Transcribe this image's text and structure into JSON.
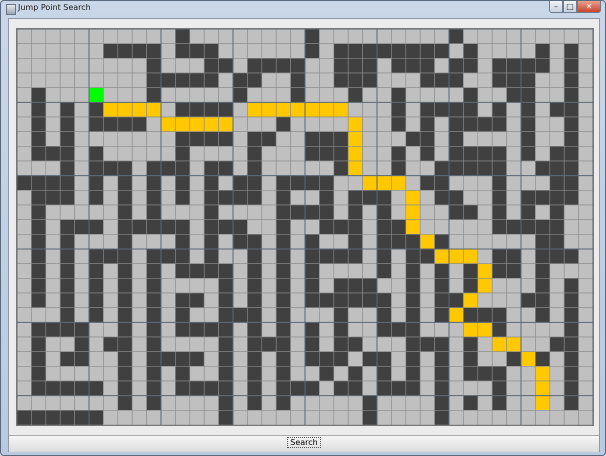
{
  "window": {
    "title": "Jump Point Search",
    "controls": {
      "minimize": "–",
      "maximize": "□",
      "close": "✕"
    }
  },
  "toolbar": {
    "search_label": "Search"
  },
  "colors": {
    "free": "#c0c0c0",
    "wall": "#404040",
    "start": "#00ff00",
    "path": "#ffc800",
    "cell_line": "#8c8c8c",
    "block_line": "#5c6878"
  },
  "grid": {
    "rows": 27,
    "cols": 40,
    "block_size": 5,
    "cells": [
      "0000000000000000000000000000000000000000",
      "00000000000000000000010001111111101000010",
      "00000000000000000000000000000000000000000",
      "0000000000000000000000000000000000000000",
      "0000000000000000000000000000000000000000",
      "0000000000000000000000000000000000000000",
      "0000000000000000000000000000000000000000",
      "0000000000000000000000000000000000000000",
      "0000000000000000000000000000000000000000",
      "0000000000000000000000000000000000000000",
      "0000000000000000000000000000000000000000",
      "0000000000000000000000000000000000000000",
      "0000000000000000000000000000000000000000",
      "0000000000000000000000000000000000000000",
      "0000000000000000000000000000000000000000",
      "0000000000000000000000000000000000000000",
      "0000000000000000000000000000000000000000",
      "0000000000000000000000000000000000000000",
      "0000000000000000000000000000000000000000",
      "0000000000000000000000000000000000000000",
      "0000000000000000000000000000000000000000",
      "0000000000000000000000000000000000000000",
      "0000000000000000000000000000000000000000",
      "0000000000000000000000000000000000000000",
      "0000000000000000000000000000000000000000",
      "0000000000000000000000000000000000000000",
      "0000000000000000000000000000000000000000"
    ],
    "walls": [
      [
        1,
        6,
        9
      ],
      [
        1,
        11,
        13
      ],
      [
        1,
        20,
        20
      ],
      [
        1,
        22,
        29
      ],
      [
        1,
        31,
        31
      ],
      [
        1,
        36,
        36
      ],
      [
        1,
        38,
        38
      ],
      [
        0,
        11,
        11
      ],
      [
        0,
        20,
        20
      ],
      [
        0,
        30,
        30
      ],
      [
        2,
        9,
        9
      ],
      [
        2,
        13,
        14
      ],
      [
        2,
        16,
        19
      ],
      [
        2,
        22,
        24
      ],
      [
        2,
        26,
        28
      ],
      [
        2,
        30,
        31
      ],
      [
        2,
        33,
        36
      ],
      [
        2,
        38,
        38
      ],
      [
        3,
        9,
        13
      ],
      [
        3,
        15,
        16
      ],
      [
        3,
        19,
        19
      ],
      [
        3,
        22,
        24
      ],
      [
        3,
        28,
        30
      ],
      [
        3,
        33,
        35
      ],
      [
        3,
        38,
        38
      ],
      [
        4,
        1,
        1
      ],
      [
        4,
        9,
        9
      ],
      [
        4,
        15,
        15
      ],
      [
        4,
        19,
        19
      ],
      [
        4,
        23,
        23
      ],
      [
        4,
        26,
        26
      ],
      [
        4,
        31,
        31
      ],
      [
        4,
        34,
        35
      ],
      [
        4,
        38,
        38
      ],
      [
        5,
        1,
        1
      ],
      [
        5,
        3,
        3
      ],
      [
        5,
        5,
        5
      ],
      [
        5,
        9,
        9
      ],
      [
        5,
        11,
        14
      ],
      [
        5,
        18,
        22
      ],
      [
        5,
        26,
        26
      ],
      [
        5,
        28,
        31
      ],
      [
        5,
        33,
        33
      ],
      [
        5,
        35,
        35
      ],
      [
        5,
        37,
        38
      ],
      [
        6,
        1,
        1
      ],
      [
        6,
        3,
        3
      ],
      [
        6,
        5,
        8
      ],
      [
        6,
        13,
        13
      ],
      [
        6,
        18,
        18
      ],
      [
        6,
        26,
        26
      ],
      [
        6,
        28,
        28
      ],
      [
        6,
        30,
        33
      ],
      [
        6,
        35,
        35
      ],
      [
        6,
        38,
        38
      ],
      [
        7,
        1,
        1
      ],
      [
        7,
        3,
        3
      ],
      [
        7,
        11,
        14
      ],
      [
        7,
        16,
        17
      ],
      [
        7,
        20,
        22
      ],
      [
        7,
        27,
        28
      ],
      [
        7,
        30,
        30
      ],
      [
        7,
        35,
        35
      ],
      [
        7,
        38,
        38
      ],
      [
        8,
        1,
        2
      ],
      [
        8,
        3,
        3
      ],
      [
        8,
        5,
        5
      ],
      [
        8,
        11,
        11
      ],
      [
        8,
        16,
        16
      ],
      [
        8,
        20,
        22
      ],
      [
        8,
        26,
        26
      ],
      [
        8,
        28,
        28
      ],
      [
        8,
        30,
        33
      ],
      [
        8,
        35,
        35
      ],
      [
        8,
        37,
        38
      ],
      [
        9,
        3,
        3
      ],
      [
        9,
        5,
        7
      ],
      [
        9,
        9,
        10
      ],
      [
        9,
        11,
        11
      ],
      [
        9,
        13,
        14
      ],
      [
        9,
        16,
        16
      ],
      [
        9,
        22,
        22
      ],
      [
        9,
        26,
        26
      ],
      [
        9,
        29,
        33
      ],
      [
        9,
        36,
        38
      ],
      [
        10,
        0,
        3
      ],
      [
        10,
        5,
        5
      ],
      [
        10,
        7,
        7
      ],
      [
        10,
        9,
        9
      ],
      [
        10,
        11,
        11
      ],
      [
        10,
        13,
        13
      ],
      [
        10,
        15,
        16
      ],
      [
        10,
        18,
        21
      ],
      [
        10,
        28,
        29
      ],
      [
        10,
        33,
        33
      ],
      [
        10,
        37,
        38
      ],
      [
        11,
        1,
        3
      ],
      [
        11,
        5,
        5
      ],
      [
        11,
        7,
        7
      ],
      [
        11,
        9,
        9
      ],
      [
        11,
        11,
        11
      ],
      [
        11,
        13,
        16
      ],
      [
        11,
        18,
        18
      ],
      [
        11,
        21,
        21
      ],
      [
        11,
        23,
        25
      ],
      [
        11,
        29,
        30
      ],
      [
        11,
        33,
        33
      ],
      [
        11,
        35,
        38
      ],
      [
        12,
        1,
        1
      ],
      [
        12,
        7,
        7
      ],
      [
        12,
        9,
        9
      ],
      [
        12,
        13,
        13
      ],
      [
        12,
        18,
        21
      ],
      [
        12,
        23,
        23
      ],
      [
        12,
        25,
        25
      ],
      [
        12,
        30,
        31
      ],
      [
        12,
        33,
        33
      ],
      [
        12,
        35,
        35
      ],
      [
        12,
        37,
        37
      ],
      [
        13,
        1,
        1
      ],
      [
        13,
        3,
        5
      ],
      [
        13,
        7,
        11
      ],
      [
        13,
        13,
        15
      ],
      [
        13,
        18,
        18
      ],
      [
        13,
        21,
        23
      ],
      [
        13,
        25,
        26
      ],
      [
        13,
        33,
        36
      ],
      [
        13,
        37,
        37
      ],
      [
        14,
        1,
        1
      ],
      [
        14,
        3,
        3
      ],
      [
        14,
        7,
        7
      ],
      [
        14,
        11,
        11
      ],
      [
        14,
        13,
        13
      ],
      [
        14,
        15,
        16
      ],
      [
        14,
        18,
        18
      ],
      [
        14,
        20,
        20
      ],
      [
        14,
        23,
        23
      ],
      [
        14,
        25,
        29
      ],
      [
        14,
        36,
        37
      ],
      [
        15,
        1,
        1
      ],
      [
        15,
        3,
        3
      ],
      [
        15,
        5,
        7
      ],
      [
        15,
        9,
        10
      ],
      [
        15,
        11,
        11
      ],
      [
        15,
        13,
        13
      ],
      [
        15,
        16,
        16
      ],
      [
        15,
        18,
        18
      ],
      [
        15,
        20,
        23
      ],
      [
        15,
        25,
        25
      ],
      [
        15,
        27,
        29
      ],
      [
        15,
        33,
        34
      ],
      [
        15,
        36,
        38
      ],
      [
        16,
        1,
        1
      ],
      [
        16,
        3,
        3
      ],
      [
        16,
        5,
        5
      ],
      [
        16,
        7,
        7
      ],
      [
        16,
        9,
        9
      ],
      [
        16,
        11,
        14
      ],
      [
        16,
        16,
        16
      ],
      [
        16,
        18,
        18
      ],
      [
        16,
        20,
        20
      ],
      [
        16,
        25,
        25
      ],
      [
        16,
        27,
        27
      ],
      [
        16,
        29,
        29
      ],
      [
        16,
        31,
        31
      ],
      [
        16,
        33,
        34
      ],
      [
        16,
        36,
        36
      ],
      [
        17,
        1,
        1
      ],
      [
        17,
        3,
        3
      ],
      [
        17,
        5,
        5
      ],
      [
        17,
        7,
        7
      ],
      [
        17,
        9,
        9
      ],
      [
        17,
        14,
        14
      ],
      [
        17,
        16,
        16
      ],
      [
        17,
        18,
        18
      ],
      [
        17,
        20,
        20
      ],
      [
        17,
        22,
        24
      ],
      [
        17,
        27,
        27
      ],
      [
        17,
        29,
        29
      ],
      [
        17,
        31,
        31
      ],
      [
        17,
        36,
        36
      ],
      [
        17,
        38,
        38
      ],
      [
        18,
        1,
        1
      ],
      [
        18,
        3,
        3
      ],
      [
        18,
        5,
        5
      ],
      [
        18,
        7,
        7
      ],
      [
        18,
        9,
        9
      ],
      [
        18,
        11,
        12
      ],
      [
        18,
        14,
        14
      ],
      [
        18,
        16,
        16
      ],
      [
        18,
        18,
        18
      ],
      [
        18,
        20,
        25
      ],
      [
        18,
        27,
        27
      ],
      [
        18,
        29,
        31
      ],
      [
        18,
        35,
        36
      ],
      [
        18,
        38,
        38
      ],
      [
        19,
        3,
        3
      ],
      [
        19,
        5,
        5
      ],
      [
        19,
        7,
        7
      ],
      [
        19,
        9,
        9
      ],
      [
        19,
        11,
        11
      ],
      [
        19,
        14,
        16
      ],
      [
        19,
        18,
        18
      ],
      [
        19,
        22,
        22
      ],
      [
        19,
        25,
        25
      ],
      [
        19,
        27,
        27
      ],
      [
        19,
        29,
        29
      ],
      [
        19,
        31,
        33
      ],
      [
        19,
        36,
        36
      ],
      [
        19,
        38,
        38
      ],
      [
        20,
        1,
        4
      ],
      [
        20,
        7,
        7
      ],
      [
        20,
        9,
        9
      ],
      [
        20,
        11,
        14
      ],
      [
        20,
        16,
        16
      ],
      [
        20,
        18,
        18
      ],
      [
        20,
        20,
        20
      ],
      [
        20,
        22,
        22
      ],
      [
        20,
        25,
        26
      ],
      [
        20,
        27,
        27
      ],
      [
        20,
        31,
        31
      ],
      [
        20,
        33,
        33
      ],
      [
        20,
        38,
        38
      ],
      [
        21,
        1,
        1
      ],
      [
        21,
        4,
        4
      ],
      [
        21,
        6,
        7
      ],
      [
        21,
        9,
        9
      ],
      [
        21,
        14,
        14
      ],
      [
        21,
        16,
        17
      ],
      [
        21,
        18,
        18
      ],
      [
        21,
        20,
        20
      ],
      [
        21,
        22,
        23
      ],
      [
        21,
        27,
        29
      ],
      [
        21,
        31,
        31
      ],
      [
        21,
        33,
        34
      ],
      [
        21,
        37,
        38
      ],
      [
        22,
        1,
        1
      ],
      [
        22,
        3,
        4
      ],
      [
        22,
        7,
        7
      ],
      [
        22,
        9,
        12
      ],
      [
        22,
        14,
        14
      ],
      [
        22,
        16,
        16
      ],
      [
        22,
        18,
        18
      ],
      [
        22,
        20,
        22
      ],
      [
        22,
        24,
        25
      ],
      [
        22,
        27,
        27
      ],
      [
        22,
        29,
        29
      ],
      [
        22,
        31,
        31
      ],
      [
        22,
        34,
        34
      ],
      [
        22,
        36,
        36
      ],
      [
        22,
        38,
        38
      ],
      [
        23,
        1,
        1
      ],
      [
        23,
        7,
        7
      ],
      [
        23,
        9,
        9
      ],
      [
        23,
        11,
        11
      ],
      [
        23,
        14,
        14
      ],
      [
        23,
        16,
        16
      ],
      [
        23,
        18,
        18
      ],
      [
        23,
        21,
        21
      ],
      [
        23,
        23,
        23
      ],
      [
        23,
        25,
        25
      ],
      [
        23,
        27,
        27
      ],
      [
        23,
        29,
        29
      ],
      [
        23,
        31,
        33
      ],
      [
        23,
        36,
        36
      ],
      [
        23,
        38,
        38
      ],
      [
        24,
        1,
        5
      ],
      [
        24,
        7,
        7
      ],
      [
        24,
        9,
        9
      ],
      [
        24,
        11,
        14
      ],
      [
        24,
        16,
        16
      ],
      [
        24,
        18,
        20
      ],
      [
        24,
        22,
        23
      ],
      [
        24,
        25,
        27
      ],
      [
        24,
        29,
        29
      ],
      [
        24,
        33,
        33
      ],
      [
        24,
        36,
        36
      ],
      [
        24,
        38,
        38
      ],
      [
        25,
        7,
        7
      ],
      [
        25,
        9,
        9
      ],
      [
        25,
        14,
        14
      ],
      [
        25,
        16,
        16
      ],
      [
        25,
        18,
        18
      ],
      [
        25,
        24,
        24
      ],
      [
        25,
        29,
        29
      ],
      [
        25,
        31,
        31
      ],
      [
        25,
        33,
        33
      ],
      [
        25,
        38,
        38
      ],
      [
        26,
        0,
        5
      ],
      [
        26,
        14,
        14
      ],
      [
        26,
        24,
        24
      ],
      [
        26,
        29,
        29
      ]
    ],
    "start": [
      4,
      5
    ],
    "path": [
      [
        5,
        6
      ],
      [
        5,
        7
      ],
      [
        5,
        8
      ],
      [
        5,
        9
      ],
      [
        6,
        10
      ],
      [
        6,
        11
      ],
      [
        6,
        12
      ],
      [
        6,
        13
      ],
      [
        6,
        14
      ],
      [
        5,
        16
      ],
      [
        5,
        17
      ],
      [
        5,
        18
      ],
      [
        5,
        19
      ],
      [
        5,
        20
      ],
      [
        5,
        21
      ],
      [
        5,
        22
      ],
      [
        6,
        23
      ],
      [
        7,
        23
      ],
      [
        8,
        23
      ],
      [
        9,
        23
      ],
      [
        10,
        24
      ],
      [
        10,
        25
      ],
      [
        10,
        26
      ],
      [
        11,
        27
      ],
      [
        12,
        27
      ],
      [
        13,
        27
      ],
      [
        14,
        28
      ],
      [
        15,
        29
      ],
      [
        15,
        30
      ],
      [
        15,
        31
      ],
      [
        16,
        32
      ],
      [
        17,
        32
      ],
      [
        18,
        31
      ],
      [
        19,
        30
      ],
      [
        20,
        31
      ],
      [
        20,
        32
      ],
      [
        21,
        33
      ],
      [
        21,
        34
      ],
      [
        22,
        35
      ],
      [
        23,
        36
      ],
      [
        24,
        36
      ],
      [
        25,
        36
      ]
    ]
  }
}
